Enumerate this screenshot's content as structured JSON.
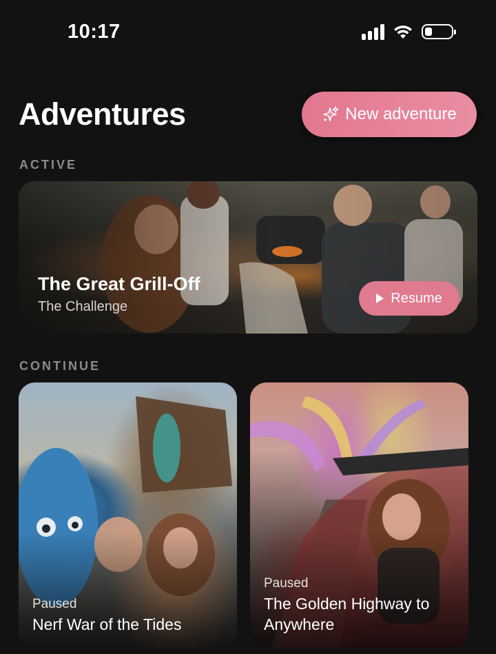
{
  "status_bar": {
    "time": "10:17"
  },
  "header": {
    "title": "Adventures",
    "new_button_label": "New adventure"
  },
  "sections": {
    "active_label": "ACTIVE",
    "continue_label": "CONTINUE"
  },
  "active": {
    "title": "The Great Grill-Off",
    "subtitle": "The Challenge",
    "action_label": "Resume"
  },
  "continue_items": [
    {
      "status": "Paused",
      "title": "Nerf War of the Tides"
    },
    {
      "status": "Paused",
      "title": "The Golden Highway to Anywhere"
    }
  ],
  "colors": {
    "accent": "#e07a8f",
    "background": "#121212",
    "section_label": "#8b8b8b"
  }
}
